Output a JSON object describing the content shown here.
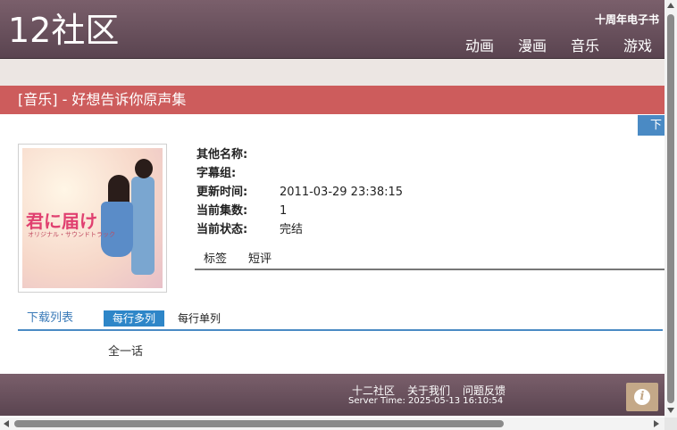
{
  "header": {
    "logo": "12社区",
    "ebook_link": "十周年电子书",
    "nav": [
      "动画",
      "漫画",
      "音乐",
      "游戏"
    ]
  },
  "title": "[音乐] - 好想告诉你原声集",
  "download_tab": "下载",
  "cover": {
    "logo_text": "君に届け",
    "subtitle": "オリジナル・サウンドトラック"
  },
  "info": {
    "rows": [
      {
        "label": "其他名称:",
        "value": ""
      },
      {
        "label": "字幕组:",
        "value": ""
      },
      {
        "label": "更新时间:",
        "value": "2011-03-29 23:38:15"
      },
      {
        "label": "当前集数:",
        "value": "1"
      },
      {
        "label": "当前状态:",
        "value": "完结"
      }
    ]
  },
  "tabs": [
    "标签",
    "短评"
  ],
  "download_list": {
    "label": "下载列表",
    "multi": "每行多列",
    "single": "每行单列"
  },
  "episodes": [
    "全一话"
  ],
  "footer": {
    "links": [
      "十二社区",
      "关于我们",
      "问题反馈"
    ],
    "server_time": "Server Time: 2025-05-13 16:10:54",
    "info_glyph": "i"
  },
  "colors": {
    "header_bg": "#6b5260",
    "title_bar": "#cd5c5c",
    "accent_blue": "#2e86c8"
  }
}
